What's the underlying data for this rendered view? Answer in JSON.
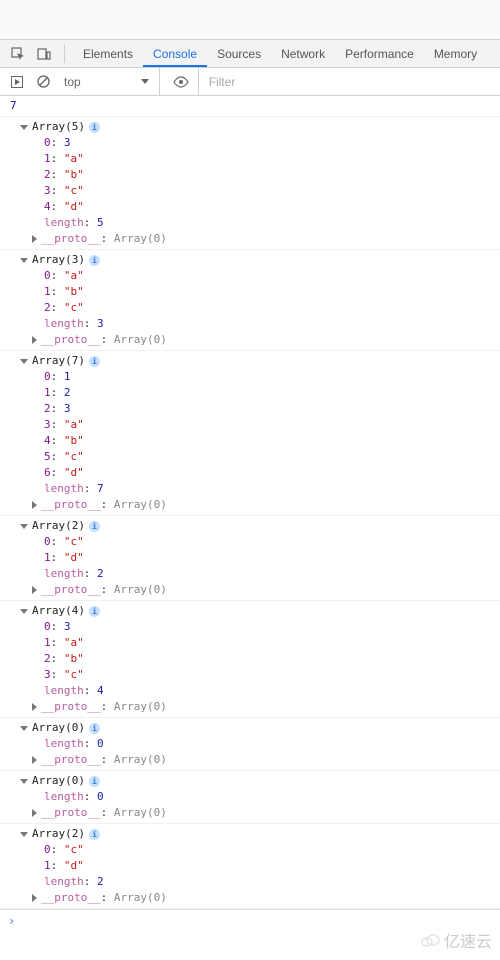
{
  "tabs": [
    "Elements",
    "Console",
    "Sources",
    "Network",
    "Performance",
    "Memory"
  ],
  "activeTab": "Console",
  "context": "top",
  "filterPlaceholder": "Filter",
  "firstLog": "7",
  "protoLabel": "__proto__",
  "protoValue": "Array(0)",
  "lengthLabel": "length",
  "info": "i",
  "arrays": [
    {
      "len": 5,
      "items": [
        3,
        "a",
        "b",
        "c",
        "d"
      ]
    },
    {
      "len": 3,
      "items": [
        "a",
        "b",
        "c"
      ]
    },
    {
      "len": 7,
      "items": [
        1,
        2,
        3,
        "a",
        "b",
        "c",
        "d"
      ]
    },
    {
      "len": 2,
      "items": [
        "c",
        "d"
      ]
    },
    {
      "len": 4,
      "items": [
        3,
        "a",
        "b",
        "c"
      ]
    },
    {
      "len": 0,
      "items": []
    },
    {
      "len": 0,
      "items": []
    },
    {
      "len": 2,
      "items": [
        "c",
        "d"
      ]
    }
  ],
  "prompt": "›",
  "watermark": "亿速云"
}
